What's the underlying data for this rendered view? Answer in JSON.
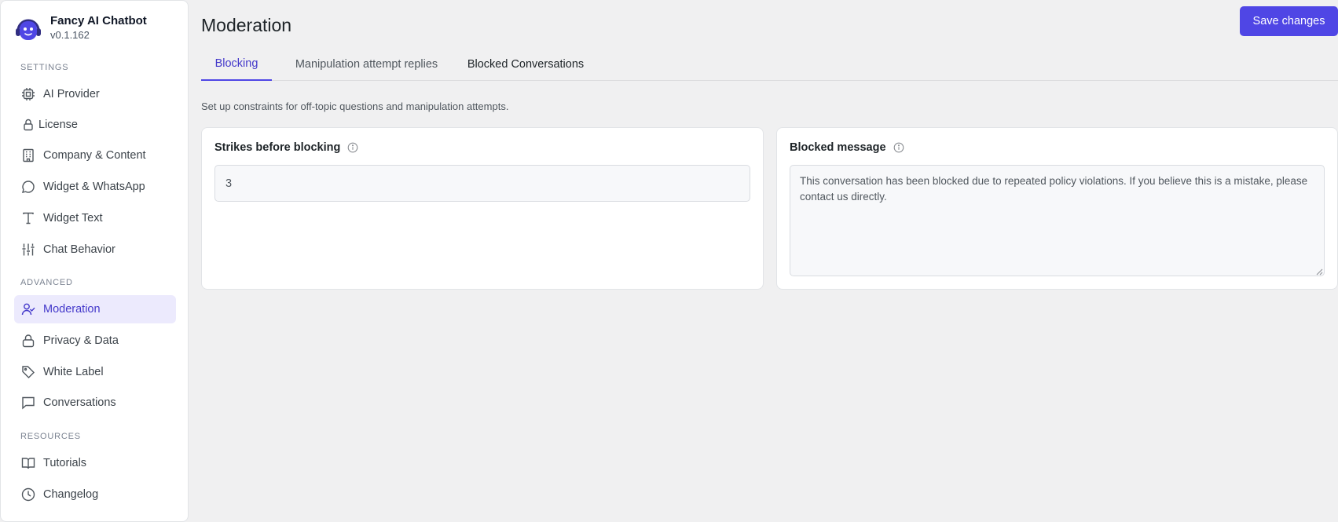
{
  "app": {
    "name": "Fancy AI Chatbot",
    "version": "v0.1.162"
  },
  "sidebar": {
    "sections": {
      "settings": "SETTINGS",
      "advanced": "ADVANCED",
      "resources": "RESOURCES"
    },
    "items": [
      {
        "label": "AI Provider",
        "icon": "cpu-icon"
      },
      {
        "label": "License",
        "icon": "lock-icon"
      },
      {
        "label": "Company & Content",
        "icon": "building-icon"
      },
      {
        "label": "Widget & WhatsApp",
        "icon": "chat-bubble-icon"
      },
      {
        "label": "Widget Text",
        "icon": "text-icon"
      },
      {
        "label": "Chat Behavior",
        "icon": "sliders-icon"
      },
      {
        "label": "Moderation",
        "icon": "user-check-icon",
        "active": true
      },
      {
        "label": "Privacy & Data",
        "icon": "lock-icon"
      },
      {
        "label": "White Label",
        "icon": "tag-icon"
      },
      {
        "label": "Conversations",
        "icon": "message-square-icon"
      },
      {
        "label": "Tutorials",
        "icon": "book-icon"
      },
      {
        "label": "Changelog",
        "icon": "clock-icon"
      }
    ]
  },
  "header": {
    "title": "Moderation",
    "save_label": "Save changes"
  },
  "tabs": [
    {
      "label": "Blocking",
      "active": true
    },
    {
      "label": "Manipulation attempt replies"
    },
    {
      "label": "Blocked Conversations"
    }
  ],
  "description": "Set up constraints for off-topic questions and manipulation attempts.",
  "strikes_card": {
    "title": "Strikes before blocking",
    "value": "3"
  },
  "blocked_card": {
    "title": "Blocked message",
    "value": "This conversation has been blocked due to repeated policy violations. If you believe this is a mistake, please contact us directly."
  },
  "colors": {
    "accent": "#4f46e5",
    "active_bg": "#eceafd",
    "background": "#f0f0f1"
  }
}
